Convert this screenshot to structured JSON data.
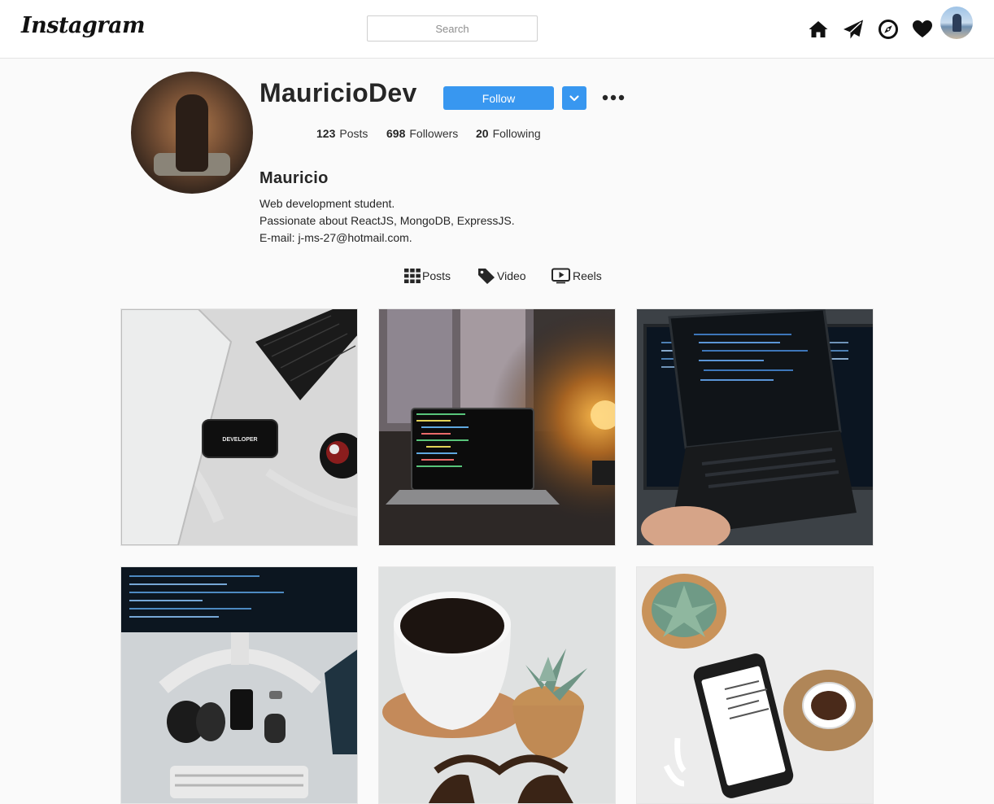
{
  "header": {
    "logo_text": "Instagram",
    "search_placeholder": "Search",
    "icons": [
      "home-icon",
      "paper-plane-icon",
      "compass-icon",
      "heart-icon"
    ]
  },
  "profile": {
    "username": "MauricioDev",
    "follow_label": "Follow",
    "stats": [
      {
        "value": "123",
        "label": "Posts"
      },
      {
        "value": "698",
        "label": "Followers"
      },
      {
        "value": "20",
        "label": "Following"
      }
    ],
    "full_name": "Mauricio",
    "bio": [
      "Web development student.",
      "Passionate about ReactJS, MongoDB, ExpressJS.",
      "E-mail: j-ms-27@hotmail.com."
    ]
  },
  "tabs": [
    {
      "label": "Posts",
      "icon": "grid-icon"
    },
    {
      "label": "Video",
      "icon": "tag-icon"
    },
    {
      "label": "Reels",
      "icon": "play-icon"
    }
  ],
  "posts": [
    {
      "photo_text": "DEVELOPER"
    },
    {
      "photo_text": ""
    },
    {
      "photo_text": ""
    },
    {
      "photo_text": ""
    },
    {
      "photo_text": ""
    },
    {
      "photo_text": ""
    }
  ],
  "colors": {
    "accent": "#3897f0",
    "background": "#fafafa",
    "text": "#262626"
  }
}
